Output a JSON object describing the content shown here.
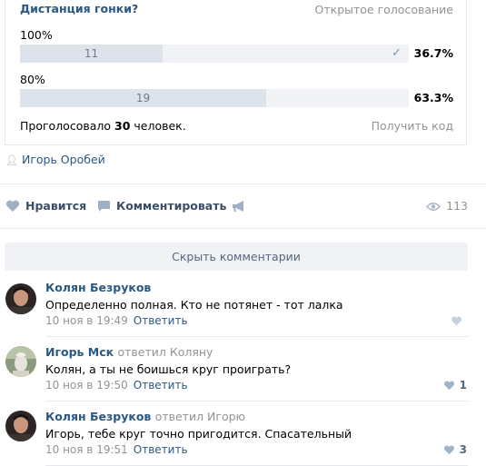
{
  "poll": {
    "title": "Дистанция гонки?",
    "type": "Открытое голосование",
    "options": [
      {
        "label": "100%",
        "count": "11",
        "percent": "36.7%",
        "fill": 0.367,
        "checked": true
      },
      {
        "label": "80%",
        "count": "19",
        "percent": "63.3%",
        "fill": 0.633,
        "checked": false
      }
    ],
    "voted_prefix": "Проголосовало ",
    "voted_count": "30",
    "voted_suffix": " человек.",
    "get_code": "Получить код"
  },
  "author": "Игорь Оробей",
  "actions": {
    "like": "Нравится",
    "comment": "Комментировать",
    "views": "113"
  },
  "comments_toggle": "Скрыть комментарии",
  "comments": [
    {
      "name": "Колян Безруков",
      "replied": "",
      "text": "Определенно полная. Кто не потянет - тот лалка",
      "time": "10 ноя в 19:49",
      "reply_label": "Ответить",
      "likes": ""
    },
    {
      "name": "Игорь Мск",
      "replied": "ответил Коляну",
      "text": "Колян, а ты не боишься круг проиграть?",
      "time": "10 ноя в 19:50",
      "reply_label": "Ответить",
      "likes": "1"
    },
    {
      "name": "Колян Безруков",
      "replied": "ответил Игорю",
      "text": "Игорь, тебе круг точно пригодится. Спасательный",
      "time": "10 ноя в 19:51",
      "reply_label": "Ответить",
      "likes": "3"
    }
  ],
  "colors": {
    "link": "#2a5885",
    "muted": "#939393",
    "bar": "#dde3ea",
    "bar_track": "#f0f2f5"
  }
}
